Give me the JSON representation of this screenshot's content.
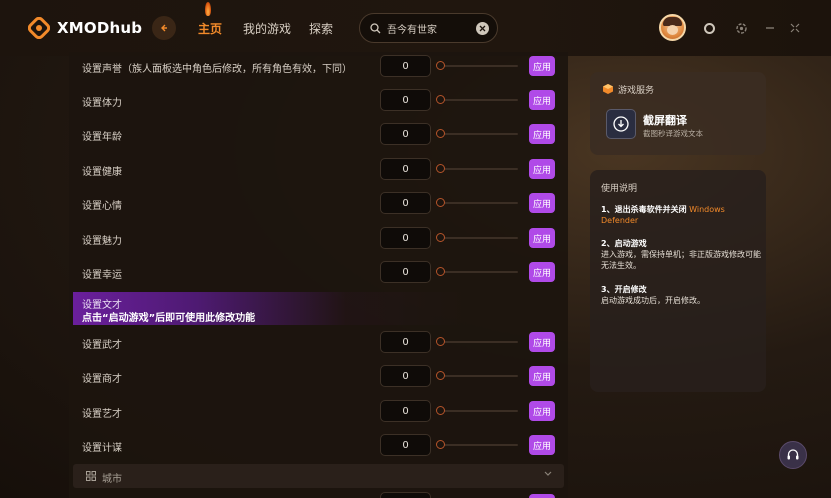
{
  "app": {
    "name": "XMODhub"
  },
  "nav": {
    "home": "主页",
    "my_games": "我的游戏",
    "explore": "探索"
  },
  "search": {
    "value": "吾今有世家"
  },
  "main": {
    "number_default": "0",
    "apply_label": "应用",
    "rows_top": [
      {
        "label": "设置声誉（族人面板选中角色后修改，所有角色有效，下同）",
        "value": "0"
      },
      {
        "label": "设置体力",
        "value": "0"
      },
      {
        "label": "设置年龄",
        "value": "0"
      },
      {
        "label": "设置健康",
        "value": "0"
      },
      {
        "label": "设置心情",
        "value": "0"
      },
      {
        "label": "设置魅力",
        "value": "0"
      },
      {
        "label": "设置幸运",
        "value": "0"
      }
    ],
    "banner": {
      "title": "设置文才",
      "warning": "点击“启动游戏”后即可使用此修改功能"
    },
    "rows_bottom": [
      {
        "label": "设置武才",
        "value": "0"
      },
      {
        "label": "设置商才",
        "value": "0"
      },
      {
        "label": "设置艺才",
        "value": "0"
      },
      {
        "label": "设置计谋",
        "value": "0"
      }
    ],
    "section": {
      "label": "城市"
    }
  },
  "service": {
    "title": "游戏服务",
    "item_name": "截屏翻译",
    "item_desc": "截图秒译游戏文本"
  },
  "help": {
    "title": "使用说明",
    "step1_title": "1、退出杀毒软件并关闭",
    "step1_highlight": "Windows Defender",
    "step2_title": "2、启动游戏",
    "step2_body": "进入游戏，需保持单机；非正版游戏修改可能无法生效。",
    "step3_title": "3、开启修改",
    "step3_body": "启动游戏成功后，开启修改。"
  },
  "colors": {
    "accent": "#f28a2a",
    "apply": "#b04ae8",
    "banner": "#6a1f9c"
  }
}
